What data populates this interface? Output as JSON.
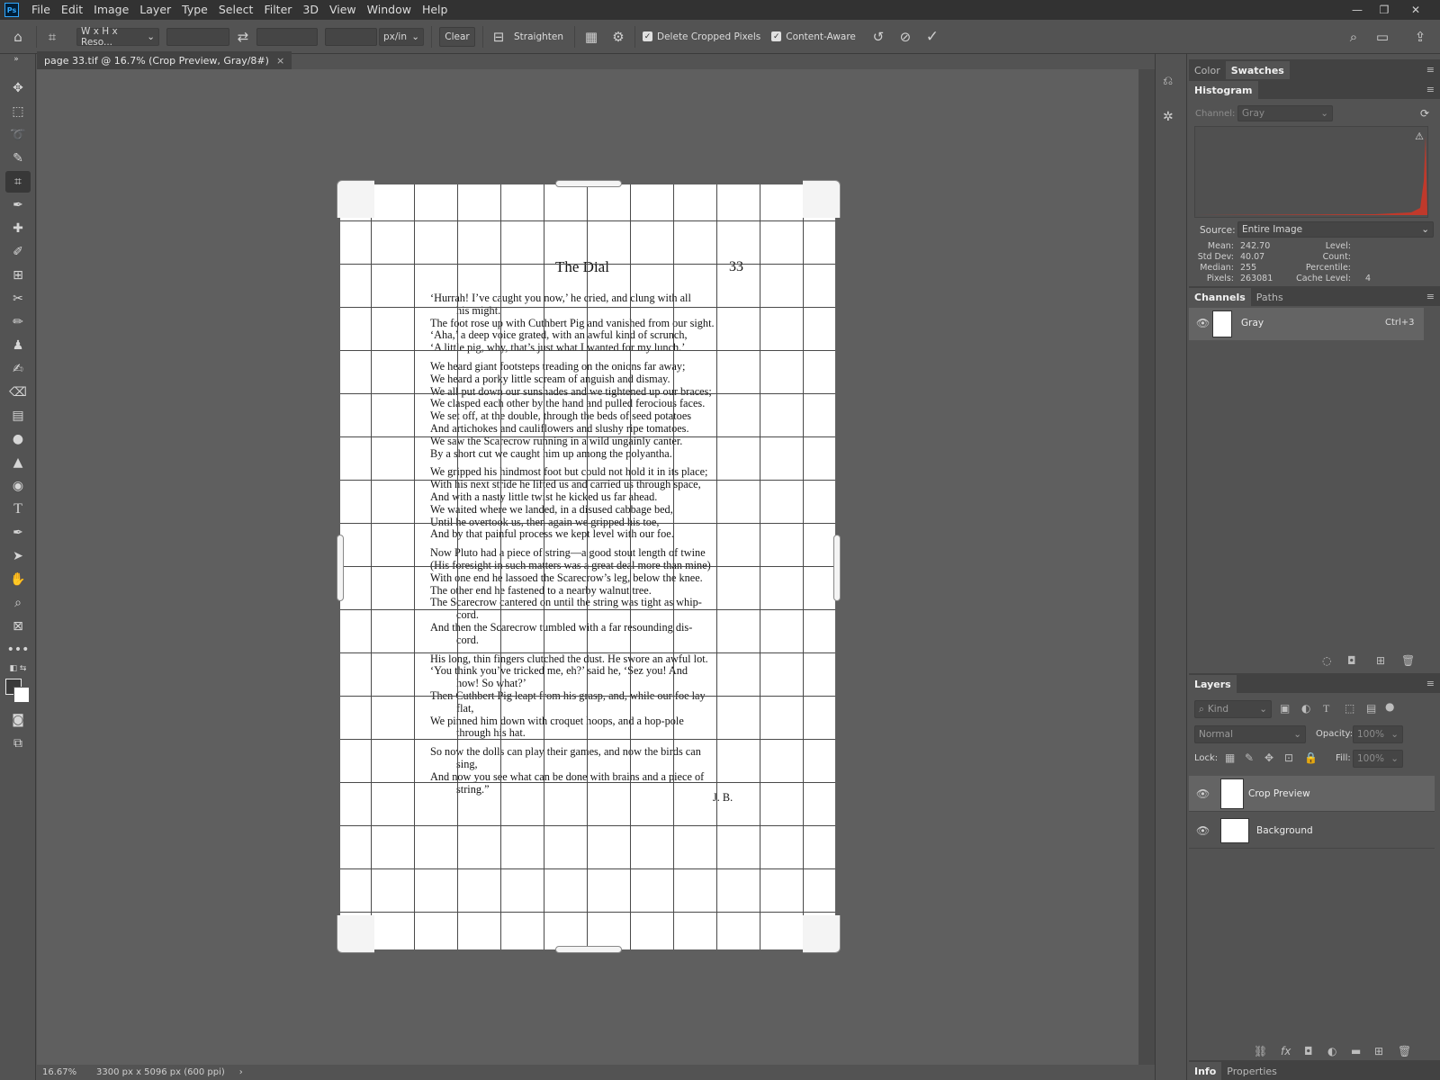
{
  "menubar": {
    "logo": "Ps",
    "items": [
      "File",
      "Edit",
      "Image",
      "Layer",
      "Type",
      "Select",
      "Filter",
      "3D",
      "View",
      "Window",
      "Help"
    ]
  },
  "options": {
    "ratio_dropdown": "W x H x Reso...",
    "units_dropdown": "px/in",
    "clear_label": "Clear",
    "straighten_label": "Straighten",
    "delete_cropped_label": "Delete Cropped Pixels",
    "content_aware_label": "Content-Aware"
  },
  "document": {
    "tab_title": "page 33.tif @ 16.7% (Crop Preview, Gray/8#)",
    "header_title": "The Dial",
    "page_number": "33",
    "lines": [
      "‘Hurrah! I’ve caught you now,’ he cried, and clung with all",
      "his might.",
      "The foot rose up with Cuthbert Pig and vanished from our sight.",
      "‘Aha,’ a deep voice grated, with an awful kind of scrunch,",
      "‘A little pig, why, that’s just what I wanted for my lunch.’",
      "We heard giant footsteps treading on the onions far away;",
      "We heard a porky little scream of anguish and dismay.",
      "We all put down our sunshades and we tightened up our braces;",
      "We clasped each other by the hand and pulled ferocious faces.",
      "We set off, at the double, through the beds of seed potatoes",
      "And artichokes and cauliflowers and slushy ripe tomatoes.",
      "We saw the Scarecrow running in a wild ungainly canter.",
      "By a short cut we caught him up among the polyantha.",
      "We gripped his hindmost foot but could not hold it in its place;",
      "With his next stride he lifted us and carried us through space,",
      "And with a nasty little twist he kicked us far ahead.",
      "We waited where we landed, in a disused cabbage bed,",
      "Until he overtook us, then again we gripped his toe,",
      "And by that painful process we kept level with our foe.",
      "Now Pluto had a piece of string—a good stout length of twine",
      "(His foresight in such matters was a great deal more than mine)",
      "With one end he lassoed the Scarecrow’s leg, below the knee.",
      "The other end he fastened to a nearby walnut tree.",
      "The Scarecrow cantered on until the string was tight as whip-",
      "cord.",
      "And then the Scarecrow tumbled with a far resounding dis-",
      "cord.",
      "His long, thin fingers clutched the dust. He swore an awful lot.",
      "‘You think you’ve tricked me, eh?’ said he, ‘Sez you! And",
      "how! So what?’",
      "Then Cuthbert Pig leapt from his grasp, and, while our foe lay",
      "flat,",
      "We pinned him down with croquet hoops, and a hop-pole",
      "through his hat.",
      "So now the dolls can play their games, and now the birds can",
      "sing,",
      "And now you see what can be done with brains and a piece of",
      "string.”"
    ],
    "signature": "J. B."
  },
  "status": {
    "zoom": "16.67%",
    "info": "3300 px x 5096 px (600 ppi)"
  },
  "panels": {
    "top_tabs": [
      "Color",
      "Swatches"
    ],
    "histogram": {
      "title": "Histogram",
      "channel_label": "Channel:",
      "channel_value": "Gray",
      "source_label": "Source:",
      "source_value": "Entire Image",
      "stats": {
        "mean_label": "Mean:",
        "mean": "242.70",
        "stddev_label": "Std Dev:",
        "stddev": "40.07",
        "median_label": "Median:",
        "median": "255",
        "pixels_label": "Pixels:",
        "pixels": "263081",
        "level_label": "Level:",
        "count_label": "Count:",
        "percentile_label": "Percentile:",
        "cache_label": "Cache Level:",
        "cache": "4"
      }
    },
    "channels": {
      "tabs": [
        "Channels",
        "Paths"
      ],
      "row_name": "Gray",
      "row_shortcut": "Ctrl+3"
    },
    "layers": {
      "title": "Layers",
      "kind_label": "Kind",
      "blend_mode": "Normal",
      "opacity_label": "Opacity:",
      "opacity_value": "100%",
      "lock_label": "Lock:",
      "fill_label": "Fill:",
      "fill_value": "100%",
      "items": [
        "Crop Preview",
        "Background"
      ]
    },
    "bottom_tabs": [
      "Info",
      "Properties"
    ]
  },
  "colors": {
    "accent_red": "#c0392b",
    "active_layer": "#646464"
  }
}
